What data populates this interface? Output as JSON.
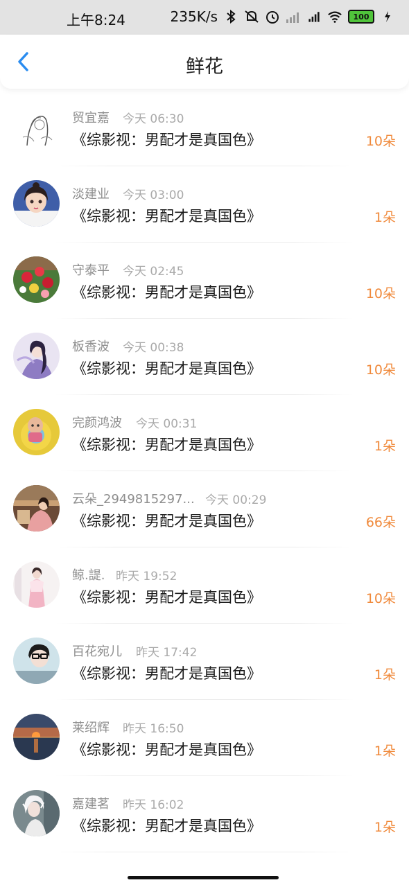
{
  "status_bar": {
    "time": "上午8:24",
    "speed": "235K/s",
    "battery": "100",
    "icons": [
      "bluetooth-icon",
      "mute-icon",
      "alarm-icon",
      "signal-icon",
      "hd-signal-icon",
      "wifi-icon",
      "battery-icon",
      "charging-icon"
    ]
  },
  "nav": {
    "title": "鲜花",
    "back_icon": "chevron-left-icon"
  },
  "items": [
    {
      "name": "贸宜嘉",
      "time": "今天 06:30",
      "book": "《综影视：男配才是真国色》",
      "count": "10朵"
    },
    {
      "name": "淡建业",
      "time": "今天 03:00",
      "book": "《综影视：男配才是真国色》",
      "count": "1朵"
    },
    {
      "name": "守泰平",
      "time": "今天 02:45",
      "book": "《综影视：男配才是真国色》",
      "count": "10朵"
    },
    {
      "name": "板香波",
      "time": "今天 00:38",
      "book": "《综影视：男配才是真国色》",
      "count": "10朵"
    },
    {
      "name": "完颜鸿波",
      "time": "今天 00:31",
      "book": "《综影视：男配才是真国色》",
      "count": "1朵"
    },
    {
      "name": "云朵_2949815297...",
      "time": "今天 00:29",
      "book": "《综影视：男配才是真国色》",
      "count": "66朵"
    },
    {
      "name": "鲸.諟.",
      "time": "昨天 19:52",
      "book": "《综影视：男配才是真国色》",
      "count": "10朵"
    },
    {
      "name": "百花宛儿",
      "time": "昨天 17:42",
      "book": "《综影视：男配才是真国色》",
      "count": "1朵"
    },
    {
      "name": "莱绍辉",
      "time": "昨天 16:50",
      "book": "《综影视：男配才是真国色》",
      "count": "1朵"
    },
    {
      "name": "嘉建茗",
      "time": "昨天 16:02",
      "book": "《综影视：男配才是真国色》",
      "count": "1朵"
    }
  ],
  "colors": {
    "accent": "#2a8cf0",
    "count": "#f08a3c",
    "name": "#8e8e8e"
  }
}
